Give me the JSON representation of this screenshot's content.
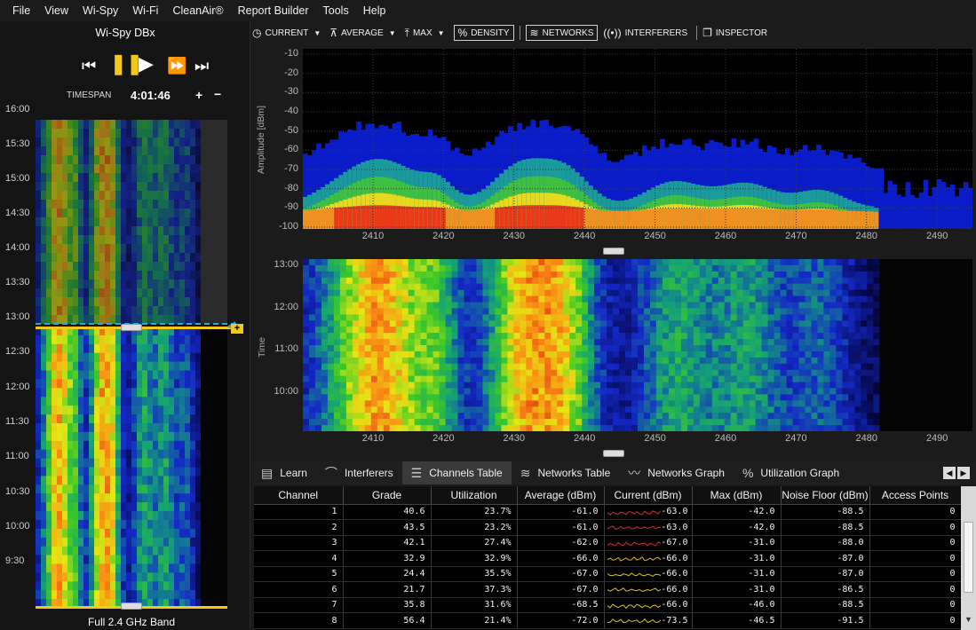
{
  "menu": [
    "File",
    "View",
    "Wi-Spy",
    "Wi-Fi",
    "CleanAir®",
    "Report Builder",
    "Tools",
    "Help"
  ],
  "device": {
    "title": "Wi-Spy DBx"
  },
  "timespan": {
    "label": "TIMESPAN",
    "value": "4:01:46",
    "plus": "+",
    "minus": "−"
  },
  "left_times": [
    "16:00",
    "15:30",
    "15:00",
    "14:30",
    "14:00",
    "13:30",
    "13:00",
    "12:30",
    "12:00",
    "11:30",
    "11:00",
    "10:30",
    "10:00",
    "9:30"
  ],
  "band_label": "Full 2.4 GHz Band",
  "toolbar": {
    "current": "CURRENT",
    "average": "AVERAGE",
    "max": "MAX",
    "density": "DENSITY",
    "networks": "NETWORKS",
    "interferers": "INTERFERERS",
    "inspector": "INSPECTOR"
  },
  "spectrum": {
    "y_title": "Amplitude [dBm]",
    "y_ticks": [
      "-10",
      "-20",
      "-30",
      "-40",
      "-50",
      "-60",
      "-70",
      "-80",
      "-90",
      "-100"
    ],
    "x_ticks": [
      "2410",
      "2420",
      "2430",
      "2440",
      "2450",
      "2460",
      "2470",
      "2480",
      "2490"
    ]
  },
  "waterfall": {
    "y_title": "Time",
    "y_ticks": [
      "13:00",
      "12:00",
      "11:00",
      "10:00"
    ],
    "x_ticks": [
      "2410",
      "2420",
      "2430",
      "2440",
      "2450",
      "2460",
      "2470",
      "2480",
      "2490"
    ]
  },
  "tabs": [
    {
      "label": "Learn",
      "icon": "book-icon",
      "active": false
    },
    {
      "label": "Interferers",
      "icon": "interferer-icon",
      "active": false
    },
    {
      "label": "Channels Table",
      "icon": "list-icon",
      "active": true
    },
    {
      "label": "Networks Table",
      "icon": "wifi-icon",
      "active": false
    },
    {
      "label": "Networks Graph",
      "icon": "graph-icon",
      "active": false
    },
    {
      "label": "Utilization Graph",
      "icon": "percent-icon",
      "active": false
    }
  ],
  "channels_table": {
    "columns": [
      "Channel",
      "Grade",
      "Utilization",
      "Average (dBm)",
      "Current (dBm)",
      "Max (dBm)",
      "Noise Floor (dBm)",
      "Access Points"
    ],
    "rows": [
      {
        "channel": "1",
        "grade": "40.6",
        "util": "23.7%",
        "avg": "-61.0",
        "cur": "-63.0",
        "max": "-42.0",
        "noise": "-88.5",
        "aps": "0",
        "spark": "#d23030"
      },
      {
        "channel": "2",
        "grade": "43.5",
        "util": "23.2%",
        "avg": "-61.0",
        "cur": "-63.0",
        "max": "-42.0",
        "noise": "-88.5",
        "aps": "0",
        "spark": "#d23030"
      },
      {
        "channel": "3",
        "grade": "42.1",
        "util": "27.4%",
        "avg": "-62.0",
        "cur": "-67.0",
        "max": "-31.0",
        "noise": "-88.0",
        "aps": "0",
        "spark": "#d23030"
      },
      {
        "channel": "4",
        "grade": "32.9",
        "util": "32.9%",
        "avg": "-66.0",
        "cur": "-66.0",
        "max": "-31.0",
        "noise": "-87.0",
        "aps": "0",
        "spark": "#e0b020"
      },
      {
        "channel": "5",
        "grade": "24.4",
        "util": "35.5%",
        "avg": "-67.0",
        "cur": "-66.0",
        "max": "-31.0",
        "noise": "-87.0",
        "aps": "0",
        "spark": "#e0c020"
      },
      {
        "channel": "6",
        "grade": "21.7",
        "util": "37.3%",
        "avg": "-67.0",
        "cur": "-66.0",
        "max": "-31.0",
        "noise": "-86.5",
        "aps": "0",
        "spark": "#e0c020"
      },
      {
        "channel": "7",
        "grade": "35.8",
        "util": "31.6%",
        "avg": "-68.5",
        "cur": "-66.0",
        "max": "-46.0",
        "noise": "-88.5",
        "aps": "0",
        "spark": "#e0c020"
      },
      {
        "channel": "8",
        "grade": "56.4",
        "util": "21.4%",
        "avg": "-72.0",
        "cur": "-73.5",
        "max": "-46.5",
        "noise": "-91.5",
        "aps": "0",
        "spark": "#e0c020"
      }
    ]
  },
  "colors": {
    "accent_yellow": "#f2c91a",
    "marker_blue": "#29a8e0",
    "background": "#1b1b1b"
  }
}
